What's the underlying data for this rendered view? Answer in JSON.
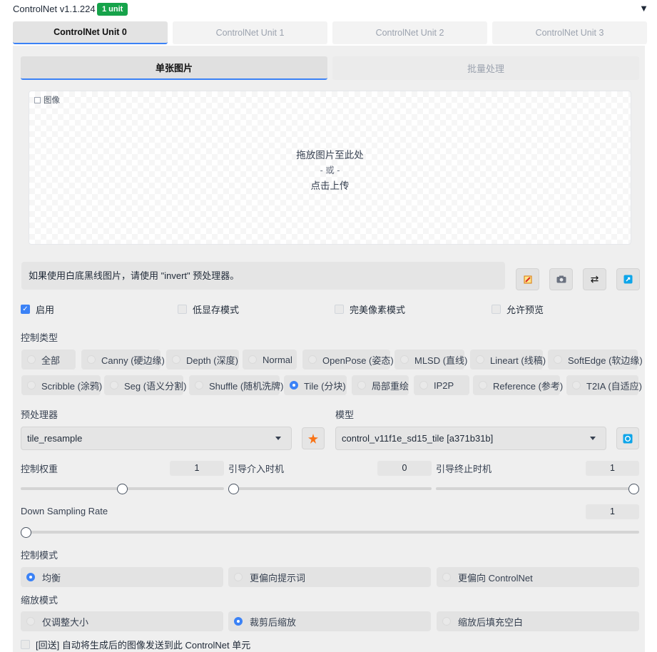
{
  "header": {
    "title": "ControlNet v1.1.224",
    "badge": "1 unit",
    "collapse_icon": "▼"
  },
  "unit_tabs": [
    {
      "label": "ControlNet Unit 0",
      "active": true
    },
    {
      "label": "ControlNet Unit 1",
      "active": false
    },
    {
      "label": "ControlNet Unit 2",
      "active": false
    },
    {
      "label": "ControlNet Unit 3",
      "active": false
    }
  ],
  "mode_tabs": [
    {
      "label": "单张图片",
      "active": true
    },
    {
      "label": "批量处理",
      "active": false
    }
  ],
  "image": {
    "label": "图像",
    "drop_line1": "拖放图片至此处",
    "drop_line2": "- 或 -",
    "drop_line3": "点击上传"
  },
  "hint": "如果使用白底黑线图片，请使用 \"invert\" 预处理器。",
  "tool_icons": [
    "edit-icon",
    "camera-icon",
    "swap-icon",
    "send-icon"
  ],
  "checkboxes": [
    {
      "label": "启用",
      "checked": true
    },
    {
      "label": "低显存模式",
      "checked": false
    },
    {
      "label": "完美像素模式",
      "checked": false
    },
    {
      "label": "允许预览",
      "checked": false
    }
  ],
  "control_type": {
    "label": "控制类型",
    "row1": [
      {
        "label": "全部",
        "selected": false
      },
      {
        "label": "Canny (硬边缘)",
        "selected": false
      },
      {
        "label": "Depth (深度)",
        "selected": false
      },
      {
        "label": "Normal",
        "selected": false
      },
      {
        "label": "OpenPose (姿态)",
        "selected": false
      },
      {
        "label": "MLSD (直线)",
        "selected": false
      },
      {
        "label": "Lineart (线稿)",
        "selected": false
      },
      {
        "label": "SoftEdge (软边缘)",
        "selected": false
      }
    ],
    "row2": [
      {
        "label": "Scribble (涂鸦)",
        "selected": false
      },
      {
        "label": "Seg (语义分割)",
        "selected": false
      },
      {
        "label": "Shuffle (随机洗牌)",
        "selected": false
      },
      {
        "label": "Tile (分块)",
        "selected": true
      },
      {
        "label": "局部重绘",
        "selected": false
      },
      {
        "label": "IP2P",
        "selected": false
      },
      {
        "label": "Reference (参考)",
        "selected": false
      },
      {
        "label": "T2IA (自适应)",
        "selected": false
      }
    ]
  },
  "preprocessor": {
    "label": "预处理器",
    "value": "tile_resample"
  },
  "model": {
    "label": "模型",
    "value": "control_v11f1e_sd15_tile [a371b31b]"
  },
  "sliders": {
    "weight": {
      "label": "控制权重",
      "value": "1",
      "fraction": 0.5
    },
    "start": {
      "label": "引导介入时机",
      "value": "0",
      "fraction": 0
    },
    "end": {
      "label": "引导终止时机",
      "value": "1",
      "fraction": 1
    },
    "down": {
      "label": "Down Sampling Rate",
      "value": "1",
      "fraction": 0
    }
  },
  "control_mode": {
    "label": "控制模式",
    "options": [
      {
        "label": "均衡",
        "selected": true
      },
      {
        "label": "更偏向提示词",
        "selected": false
      },
      {
        "label": "更偏向 ControlNet",
        "selected": false
      }
    ]
  },
  "resize_mode": {
    "label": "缩放模式",
    "options": [
      {
        "label": "仅调整大小",
        "selected": false
      },
      {
        "label": "裁剪后缩放",
        "selected": true
      },
      {
        "label": "缩放后填充空白",
        "selected": false
      }
    ]
  },
  "loopback": {
    "label": "[回送] 自动将生成后的图像发送到此 ControlNet 单元",
    "checked": false
  }
}
